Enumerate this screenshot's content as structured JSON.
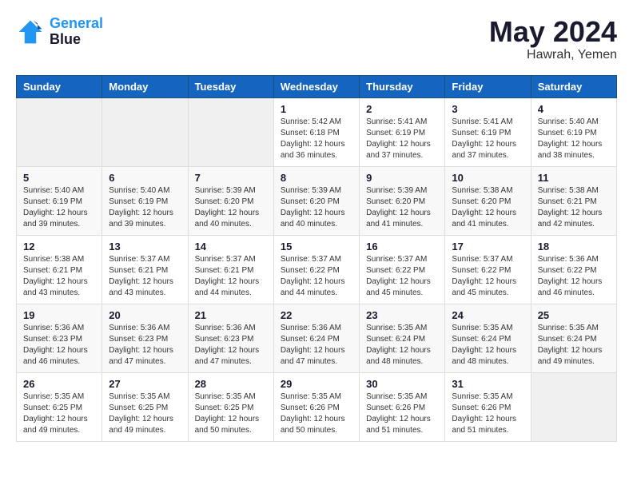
{
  "header": {
    "logo_line1": "General",
    "logo_line2": "Blue",
    "month": "May 2024",
    "location": "Hawrah, Yemen"
  },
  "weekdays": [
    "Sunday",
    "Monday",
    "Tuesday",
    "Wednesday",
    "Thursday",
    "Friday",
    "Saturday"
  ],
  "weeks": [
    [
      {
        "day": null
      },
      {
        "day": null
      },
      {
        "day": null
      },
      {
        "day": "1",
        "sunrise": "5:42 AM",
        "sunset": "6:18 PM",
        "daylight": "12 hours and 36 minutes."
      },
      {
        "day": "2",
        "sunrise": "5:41 AM",
        "sunset": "6:19 PM",
        "daylight": "12 hours and 37 minutes."
      },
      {
        "day": "3",
        "sunrise": "5:41 AM",
        "sunset": "6:19 PM",
        "daylight": "12 hours and 37 minutes."
      },
      {
        "day": "4",
        "sunrise": "5:40 AM",
        "sunset": "6:19 PM",
        "daylight": "12 hours and 38 minutes."
      }
    ],
    [
      {
        "day": "5",
        "sunrise": "5:40 AM",
        "sunset": "6:19 PM",
        "daylight": "12 hours and 39 minutes."
      },
      {
        "day": "6",
        "sunrise": "5:40 AM",
        "sunset": "6:19 PM",
        "daylight": "12 hours and 39 minutes."
      },
      {
        "day": "7",
        "sunrise": "5:39 AM",
        "sunset": "6:20 PM",
        "daylight": "12 hours and 40 minutes."
      },
      {
        "day": "8",
        "sunrise": "5:39 AM",
        "sunset": "6:20 PM",
        "daylight": "12 hours and 40 minutes."
      },
      {
        "day": "9",
        "sunrise": "5:39 AM",
        "sunset": "6:20 PM",
        "daylight": "12 hours and 41 minutes."
      },
      {
        "day": "10",
        "sunrise": "5:38 AM",
        "sunset": "6:20 PM",
        "daylight": "12 hours and 41 minutes."
      },
      {
        "day": "11",
        "sunrise": "5:38 AM",
        "sunset": "6:21 PM",
        "daylight": "12 hours and 42 minutes."
      }
    ],
    [
      {
        "day": "12",
        "sunrise": "5:38 AM",
        "sunset": "6:21 PM",
        "daylight": "12 hours and 43 minutes."
      },
      {
        "day": "13",
        "sunrise": "5:37 AM",
        "sunset": "6:21 PM",
        "daylight": "12 hours and 43 minutes."
      },
      {
        "day": "14",
        "sunrise": "5:37 AM",
        "sunset": "6:21 PM",
        "daylight": "12 hours and 44 minutes."
      },
      {
        "day": "15",
        "sunrise": "5:37 AM",
        "sunset": "6:22 PM",
        "daylight": "12 hours and 44 minutes."
      },
      {
        "day": "16",
        "sunrise": "5:37 AM",
        "sunset": "6:22 PM",
        "daylight": "12 hours and 45 minutes."
      },
      {
        "day": "17",
        "sunrise": "5:37 AM",
        "sunset": "6:22 PM",
        "daylight": "12 hours and 45 minutes."
      },
      {
        "day": "18",
        "sunrise": "5:36 AM",
        "sunset": "6:22 PM",
        "daylight": "12 hours and 46 minutes."
      }
    ],
    [
      {
        "day": "19",
        "sunrise": "5:36 AM",
        "sunset": "6:23 PM",
        "daylight": "12 hours and 46 minutes."
      },
      {
        "day": "20",
        "sunrise": "5:36 AM",
        "sunset": "6:23 PM",
        "daylight": "12 hours and 47 minutes."
      },
      {
        "day": "21",
        "sunrise": "5:36 AM",
        "sunset": "6:23 PM",
        "daylight": "12 hours and 47 minutes."
      },
      {
        "day": "22",
        "sunrise": "5:36 AM",
        "sunset": "6:24 PM",
        "daylight": "12 hours and 47 minutes."
      },
      {
        "day": "23",
        "sunrise": "5:35 AM",
        "sunset": "6:24 PM",
        "daylight": "12 hours and 48 minutes."
      },
      {
        "day": "24",
        "sunrise": "5:35 AM",
        "sunset": "6:24 PM",
        "daylight": "12 hours and 48 minutes."
      },
      {
        "day": "25",
        "sunrise": "5:35 AM",
        "sunset": "6:24 PM",
        "daylight": "12 hours and 49 minutes."
      }
    ],
    [
      {
        "day": "26",
        "sunrise": "5:35 AM",
        "sunset": "6:25 PM",
        "daylight": "12 hours and 49 minutes."
      },
      {
        "day": "27",
        "sunrise": "5:35 AM",
        "sunset": "6:25 PM",
        "daylight": "12 hours and 49 minutes."
      },
      {
        "day": "28",
        "sunrise": "5:35 AM",
        "sunset": "6:25 PM",
        "daylight": "12 hours and 50 minutes."
      },
      {
        "day": "29",
        "sunrise": "5:35 AM",
        "sunset": "6:26 PM",
        "daylight": "12 hours and 50 minutes."
      },
      {
        "day": "30",
        "sunrise": "5:35 AM",
        "sunset": "6:26 PM",
        "daylight": "12 hours and 51 minutes."
      },
      {
        "day": "31",
        "sunrise": "5:35 AM",
        "sunset": "6:26 PM",
        "daylight": "12 hours and 51 minutes."
      },
      {
        "day": null
      }
    ]
  ]
}
